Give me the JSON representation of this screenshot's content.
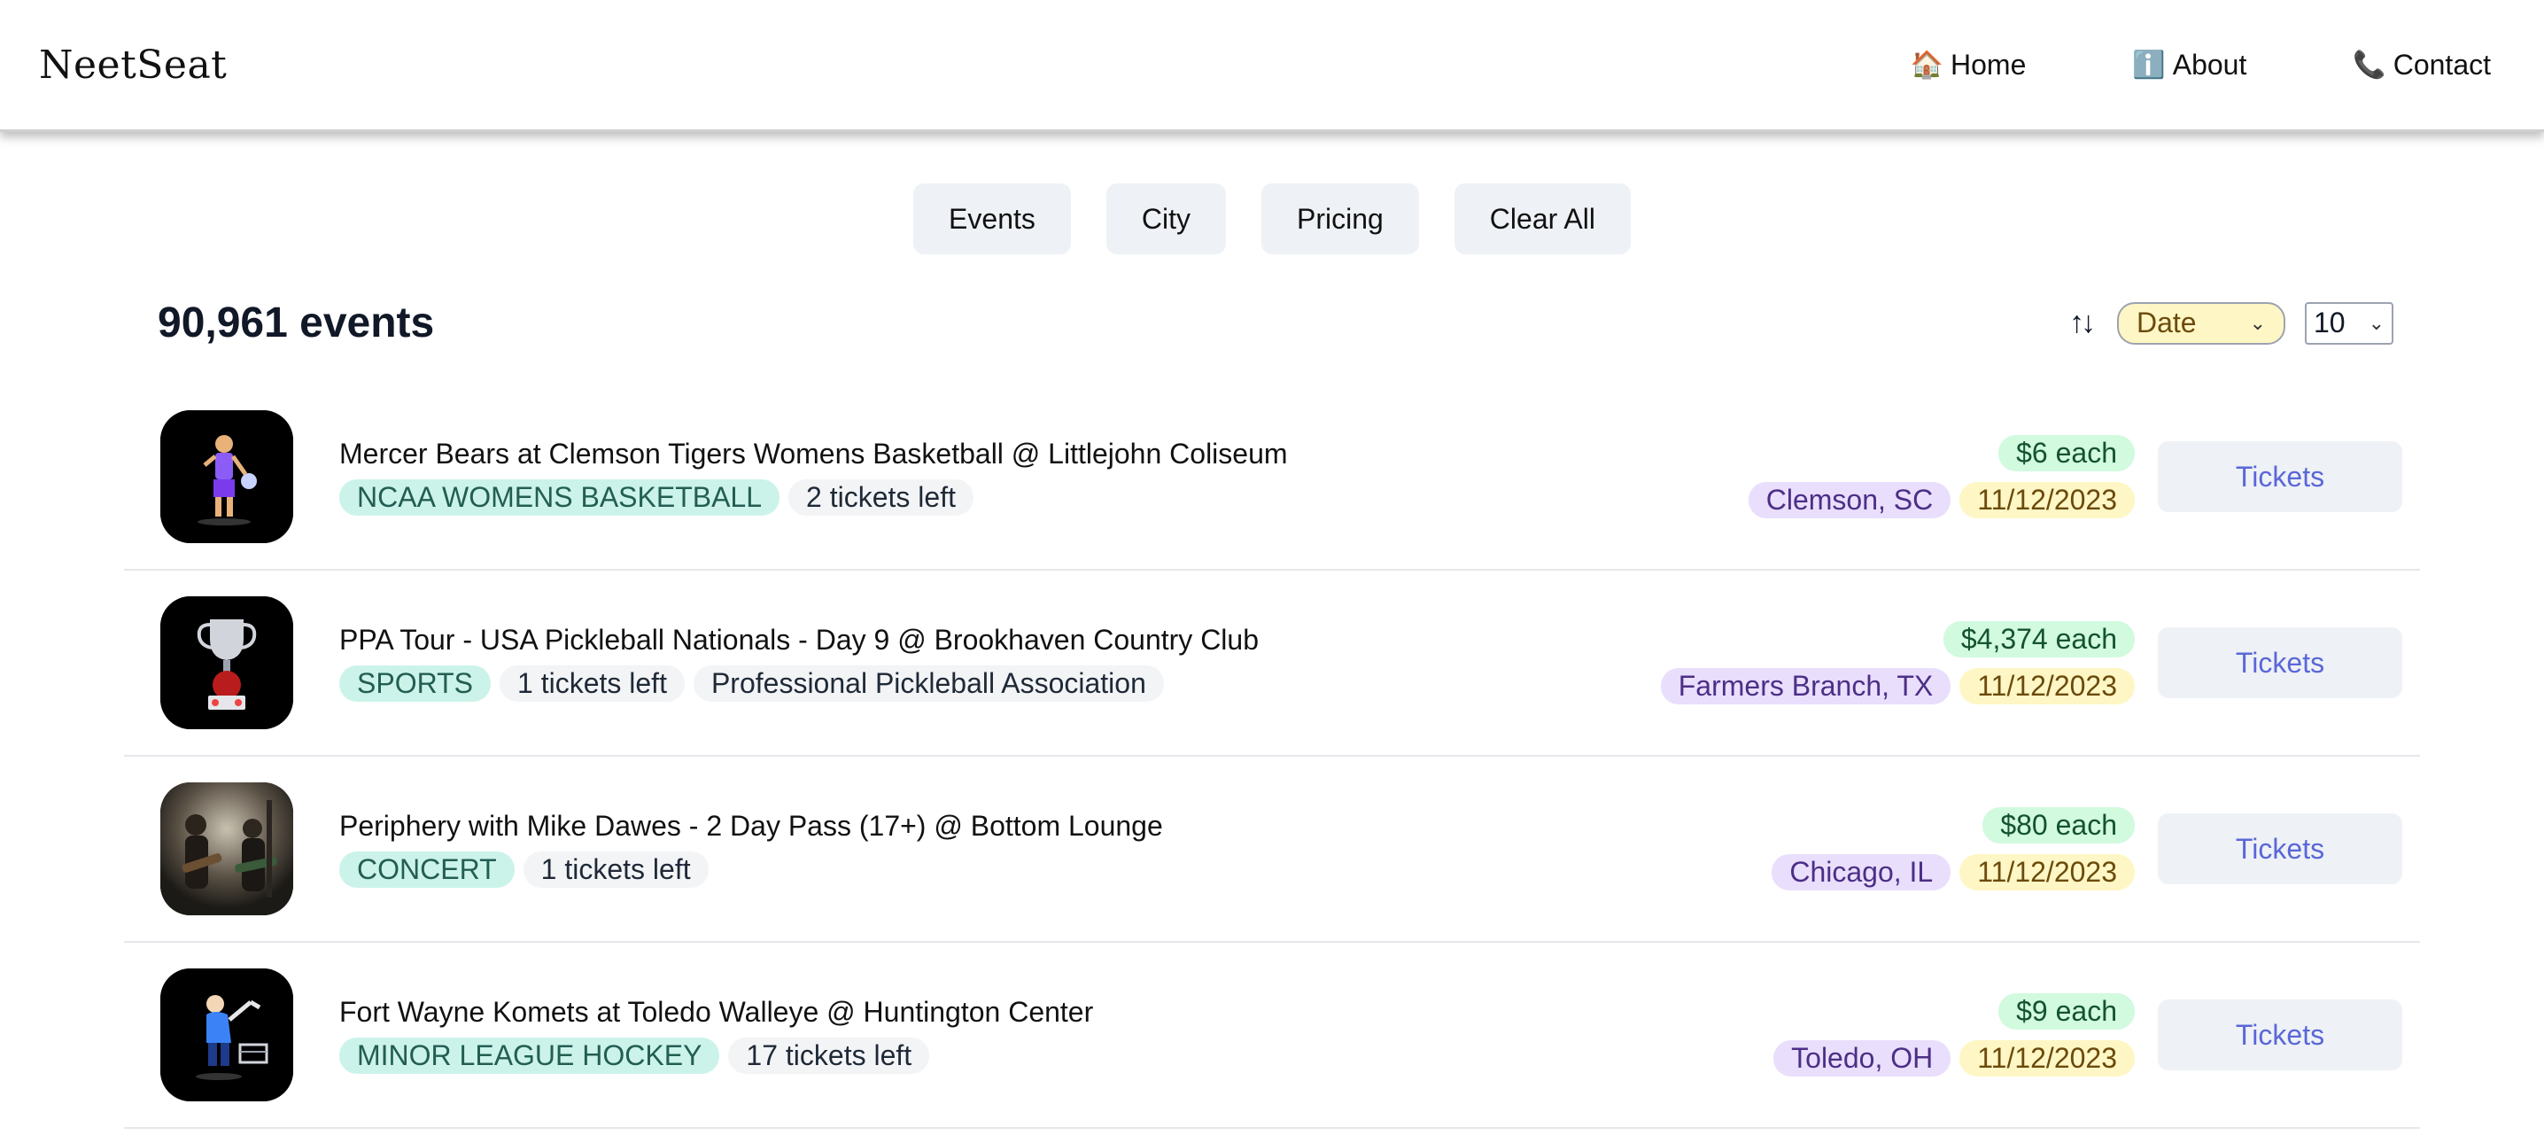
{
  "header": {
    "brand": "NeetSeat",
    "nav": [
      {
        "icon": "🏠",
        "label": "Home"
      },
      {
        "icon": "ℹ️",
        "label": "About"
      },
      {
        "icon": "📞",
        "label": "Contact"
      }
    ]
  },
  "filters": [
    "Events",
    "City",
    "Pricing",
    "Clear All"
  ],
  "toolbar": {
    "count": "90,961 events",
    "sort_icon": "↑↓",
    "sort_by": "Date",
    "page_size": "10"
  },
  "events": [
    {
      "title": "Mercer Bears at Clemson Tigers Womens Basketball @ Littlejohn Coliseum",
      "category": "NCAA WOMENS BASKETBALL",
      "tickets_left": "2 tickets left",
      "extra": "",
      "price": "$6 each",
      "city": "Clemson, SC",
      "date": "11/12/2023",
      "button": "Tickets",
      "image": "basketball-player-icon"
    },
    {
      "title": "PPA Tour - USA Pickleball Nationals - Day 9 @ Brookhaven Country Club",
      "category": "SPORTS",
      "tickets_left": "1 tickets left",
      "extra": "Professional Pickleball Association",
      "price": "$4,374 each",
      "city": "Farmers Branch, TX",
      "date": "11/12/2023",
      "button": "Tickets",
      "image": "trophy-icon"
    },
    {
      "title": "Periphery with Mike Dawes - 2 Day Pass (17+) @ Bottom Lounge",
      "category": "CONCERT",
      "tickets_left": "1 tickets left",
      "extra": "",
      "price": "$80 each",
      "city": "Chicago, IL",
      "date": "11/12/2023",
      "button": "Tickets",
      "image": "concert-photo"
    },
    {
      "title": "Fort Wayne Komets at Toledo Walleye @ Huntington Center",
      "category": "MINOR LEAGUE HOCKEY",
      "tickets_left": "17 tickets left",
      "extra": "",
      "price": "$9 each",
      "city": "Toledo, OH",
      "date": "11/12/2023",
      "button": "Tickets",
      "image": "hockey-player-icon"
    }
  ]
}
